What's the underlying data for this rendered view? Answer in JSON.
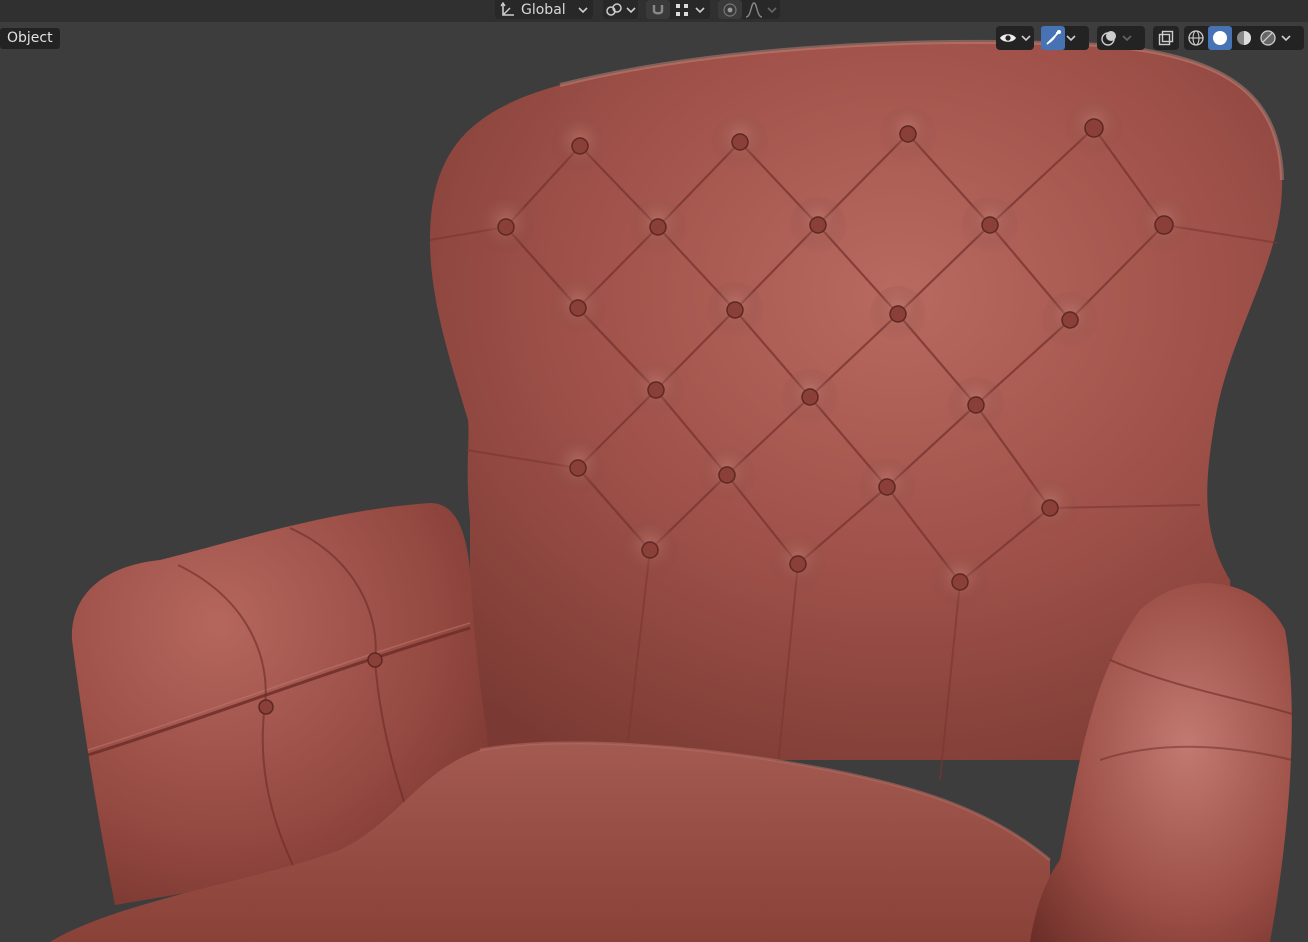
{
  "header": {
    "transform_orientation": "Global",
    "pivot_icon": "pivot-link-icon",
    "snap_icon": "magnet-icon",
    "snap_target_icon": "snap-grid-icon",
    "proportional_icon": "proportional-edit-icon",
    "falloff_icon": "falloff-curve-icon"
  },
  "viewport": {
    "mode_label": "Object",
    "background_color": "#3d3d3d",
    "object_color": "#9c4a40"
  },
  "overlays": {
    "visibility_icon": "eye-icon",
    "gizmo_icon": "gizmo-icon",
    "overlay_icon": "overlay-icon",
    "xray_icon": "xray-icon",
    "shading_modes": [
      "wireframe",
      "solid",
      "material-preview",
      "rendered"
    ],
    "active_shading": "solid",
    "accent_color": "#4772b3"
  }
}
